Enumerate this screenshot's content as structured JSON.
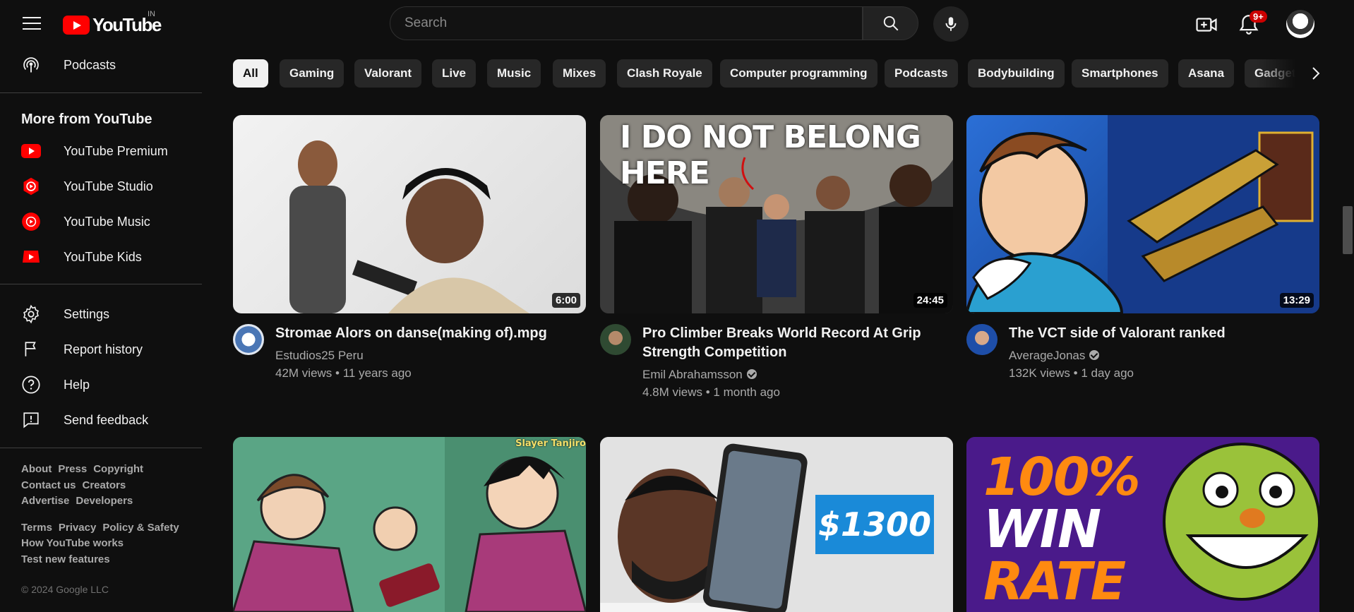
{
  "header": {
    "logo_text": "YouTube",
    "country": "IN",
    "search_placeholder": "Search",
    "notif_badge": "9+"
  },
  "sidebar": {
    "podcasts": "Podcasts",
    "more_heading": "More from YouTube",
    "more_items": [
      "YouTube Premium",
      "YouTube Studio",
      "YouTube Music",
      "YouTube Kids"
    ],
    "settings_items": [
      "Settings",
      "Report history",
      "Help",
      "Send feedback"
    ],
    "footer1": [
      "About",
      "Press",
      "Copyright"
    ],
    "footer2": [
      "Contact us",
      "Creators"
    ],
    "footer3": [
      "Advertise",
      "Developers"
    ],
    "footer4": [
      "Terms",
      "Privacy",
      "Policy & Safety"
    ],
    "footer5": "How YouTube works",
    "footer6": "Test new features",
    "copyright": "© 2024 Google LLC"
  },
  "chips": [
    "All",
    "Gaming",
    "Valorant",
    "Live",
    "Music",
    "Mixes",
    "Clash Royale",
    "Computer programming",
    "Podcasts",
    "Bodybuilding",
    "Smartphones",
    "Asana",
    "Gadgets"
  ],
  "videos": [
    {
      "title": "Stromae Alors on danse(making of).mpg",
      "channel": "Estudios25 Peru",
      "meta": "42M views • 11 years ago",
      "duration": "6:00"
    },
    {
      "title_line1": "Pro Climber Breaks World Record At Grip",
      "title_line2": "Strength Competition",
      "channel": "Emil Abrahamsson",
      "meta": "4.8M views • 1 month ago",
      "duration": "24:45",
      "thumb_text": "I DO NOT BELONG HERE"
    },
    {
      "title": "The VCT side of Valorant ranked",
      "channel": "AverageJonas",
      "meta": "132K views • 1 day ago",
      "duration": "13:29"
    },
    {
      "thumb_text": "Slayer Tanjiro"
    },
    {
      "thumb_text": "$1300"
    },
    {
      "thumb_text_line1": "100%",
      "thumb_text_line2": "WIN",
      "thumb_text_line3": "RATE"
    }
  ]
}
